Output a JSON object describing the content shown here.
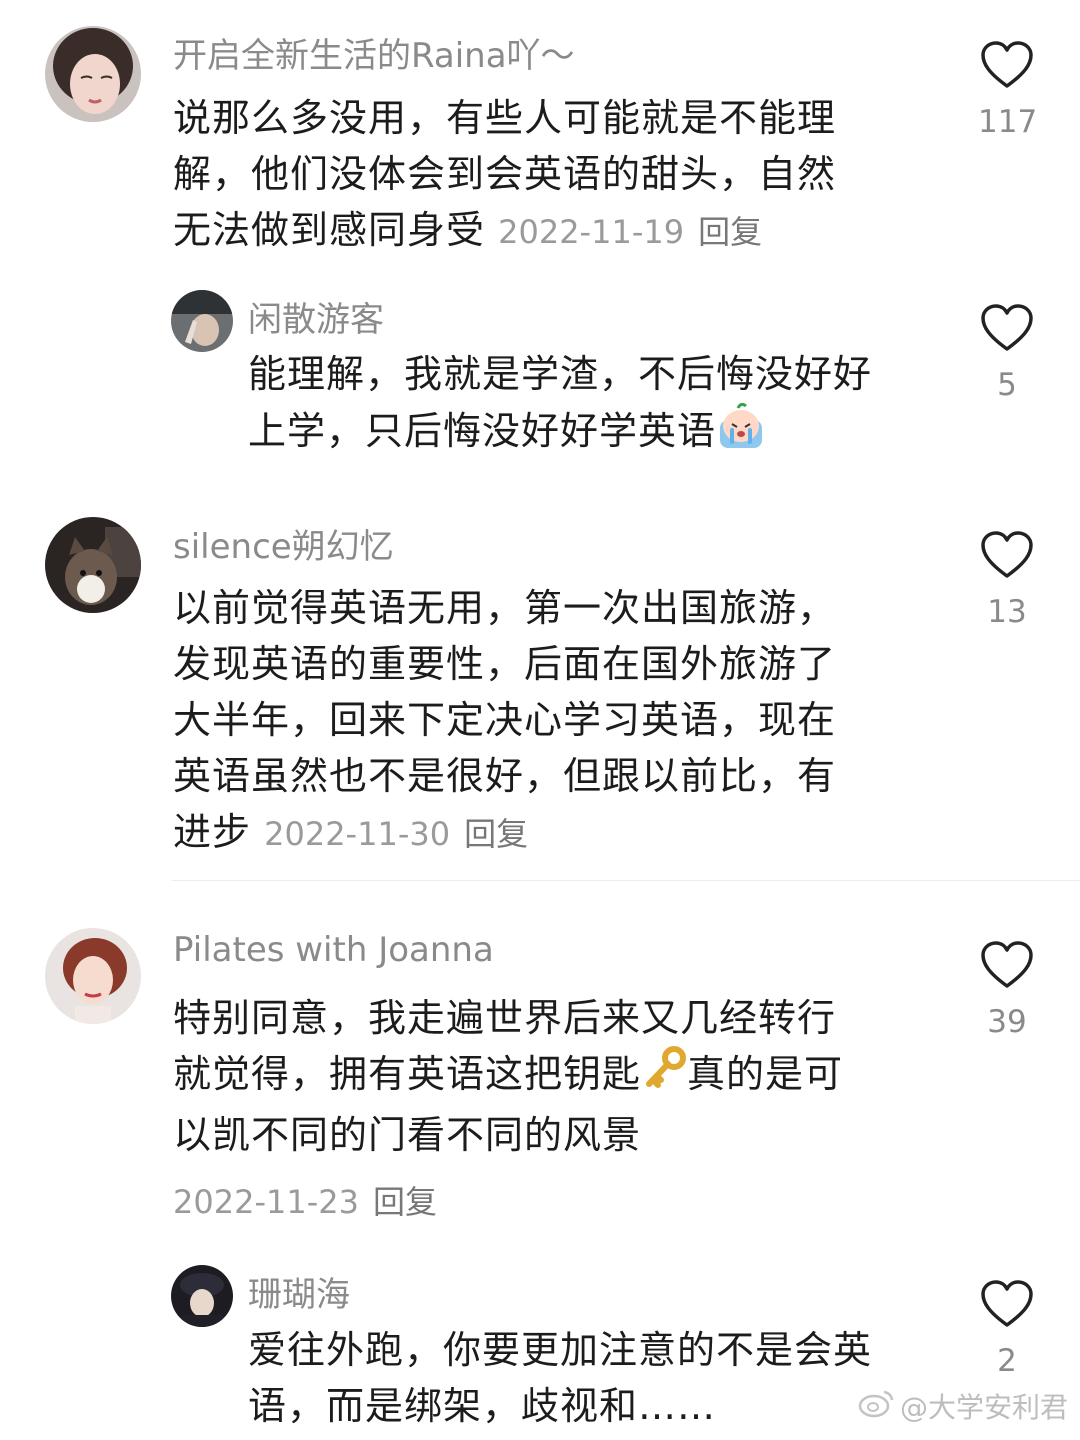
{
  "comments": [
    {
      "username": "开启全新生活的Raina吖～",
      "lines": [
        "说那么多没用，有些人可能就是不能理",
        "解，他们没体会到会英语的甜头，自然",
        "无法做到感同身受"
      ],
      "date": "2022-11-19",
      "reply": "回复",
      "likes": "117"
    },
    {
      "username": "闲散游客",
      "lines": [
        "能理解，我就是学渣，不后悔没好好",
        "上学，只后悔没好好学英语"
      ],
      "likes": "5"
    },
    {
      "username": "silence朔幻忆",
      "lines": [
        "以前觉得英语无用，第一次出国旅游，",
        "发现英语的重要性，后面在国外旅游了",
        "大半年，回来下定决心学习英语，现在",
        "英语虽然也不是很好，但跟以前比，有",
        "进步"
      ],
      "date": "2022-11-30",
      "reply": "回复",
      "likes": "13"
    },
    {
      "username": "Pilates with Joanna",
      "lines": [
        "特别同意，我走遍世界后来又几经转行",
        "就觉得，拥有英语这把钥匙",
        "真的是可",
        "以凯不同的门看不同的风景"
      ],
      "date": "2022-11-23",
      "reply": "回复",
      "likes": "39"
    },
    {
      "username": "珊瑚海",
      "lines": [
        "爱往外跑，你要更加注意的不是会英",
        "语，而是绑架，歧视和……"
      ],
      "likes": "2"
    }
  ],
  "watermark": "@大学安利君",
  "icons": {
    "like": "heart-outline-icon",
    "crying_emoji": "crying-face-emoji-icon",
    "key_emoji": "key-emoji-icon",
    "weibo": "weibo-logo-icon"
  }
}
